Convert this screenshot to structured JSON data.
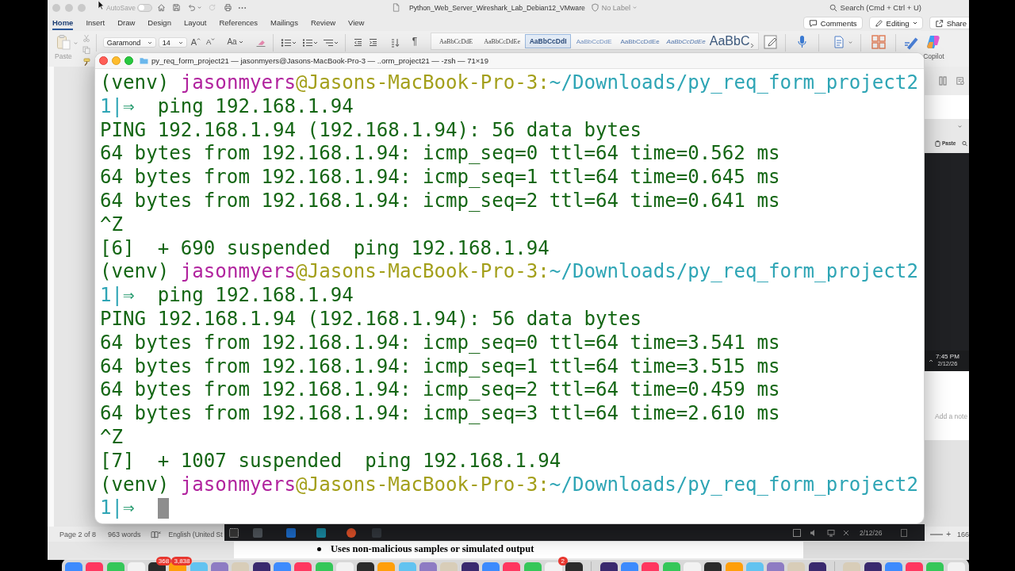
{
  "word": {
    "titlebar": {
      "autosave_label": "AutoSave",
      "autosave_on": false,
      "document_title": "Python_Web_Server_Wireshark_Lab_Debian12_VMware",
      "sensitivity_label": "No Label",
      "search": {
        "placeholder": "Search (Cmd + Ctrl + U)"
      }
    },
    "tabs": [
      {
        "label": "Home",
        "selected": true
      },
      {
        "label": "Insert",
        "selected": false
      },
      {
        "label": "Draw",
        "selected": false
      },
      {
        "label": "Design",
        "selected": false
      },
      {
        "label": "Layout",
        "selected": false
      },
      {
        "label": "References",
        "selected": false
      },
      {
        "label": "Mailings",
        "selected": false
      },
      {
        "label": "Review",
        "selected": false
      },
      {
        "label": "View",
        "selected": false
      }
    ],
    "actions": [
      {
        "kind": "comments",
        "label": "Comments"
      },
      {
        "kind": "editing",
        "label": "Editing"
      },
      {
        "kind": "share",
        "label": "Share"
      }
    ],
    "ribbon": {
      "paste_label": "Paste",
      "font": "Garamond",
      "font_size": "14",
      "font_buttons": [
        {
          "kind": "grow",
          "label": "A"
        },
        {
          "kind": "shrink",
          "label": "A"
        }
      ],
      "change_case_label": "Aa",
      "formatting_marks": "¶",
      "styles": [
        {
          "kind": "normal",
          "sample": "AaBbCcDdE",
          "selected": false
        },
        {
          "kind": "no-spacing",
          "sample": "AaBbCcDdEe",
          "selected": false
        },
        {
          "kind": "heading-1",
          "sample": "AaBbCcDdI",
          "selected": true
        },
        {
          "kind": "heading-2",
          "sample": "AaBbCcDdE",
          "selected": false
        },
        {
          "kind": "heading-3",
          "sample": "AaBbCcDdEe",
          "selected": false
        },
        {
          "kind": "subtle",
          "sample": "AaBbCcDdEe",
          "selected": false
        },
        {
          "kind": "title",
          "sample": "AaBbC",
          "selected": false
        }
      ],
      "copilot_label": "Copilot"
    },
    "notes": {
      "placeholder": "Add a note"
    },
    "status_bar": {
      "page": "Page 2 of 8",
      "words": "963 words",
      "language": "English (United St",
      "zoom_in": "+",
      "zoom": "166"
    },
    "document": {
      "bullets": [
        "Uses non-malicious samples or simulated output"
      ]
    }
  },
  "vm_window": {
    "toolbar_label": "Paste",
    "time": "7:45 PM",
    "date": "2/12/26"
  },
  "vm_taskbar": {
    "date": "2/12/26"
  },
  "terminal": {
    "title": "py_req_form_project21 — jasonmyers@Jasons-MacBook-Pro-3 — ..orm_project21 — -zsh — 71×19",
    "cursor_visible": true,
    "lines": [
      {
        "segments": [
          {
            "text": "(venv) ",
            "color": "#146614"
          },
          {
            "text": "jasonmyers",
            "color": "#b1239e"
          },
          {
            "text": "@Jasons-MacBook-Pro-3:",
            "color": "#a39f1a"
          },
          {
            "text": "~/Downloads/py_req_form_project2",
            "color": "#2ea5b5"
          }
        ]
      },
      {
        "segments": [
          {
            "text": "1|",
            "color": "#2ea5b5"
          },
          {
            "text": "⇒",
            "color": "#259a6e"
          },
          {
            "text": "  ping 192.168.1.94",
            "color": "#146614"
          }
        ]
      },
      {
        "segments": [
          {
            "text": "PING 192.168.1.94 (192.168.1.94): 56 data bytes",
            "color": "#146614"
          }
        ]
      },
      {
        "segments": [
          {
            "text": "64 bytes from 192.168.1.94: icmp_seq=0 ttl=64 time=0.562 ms",
            "color": "#146614"
          }
        ]
      },
      {
        "segments": [
          {
            "text": "64 bytes from 192.168.1.94: icmp_seq=1 ttl=64 time=0.645 ms",
            "color": "#146614"
          }
        ]
      },
      {
        "segments": [
          {
            "text": "64 bytes from 192.168.1.94: icmp_seq=2 ttl=64 time=0.641 ms",
            "color": "#146614"
          }
        ]
      },
      {
        "segments": [
          {
            "text": "^Z",
            "color": "#146614"
          }
        ]
      },
      {
        "segments": [
          {
            "text": "[6]  + 690 suspended  ping 192.168.1.94",
            "color": "#146614"
          }
        ]
      },
      {
        "segments": [
          {
            "text": "(venv) ",
            "color": "#146614"
          },
          {
            "text": "jasonmyers",
            "color": "#b1239e"
          },
          {
            "text": "@Jasons-MacBook-Pro-3:",
            "color": "#a39f1a"
          },
          {
            "text": "~/Downloads/py_req_form_project2",
            "color": "#2ea5b5"
          }
        ]
      },
      {
        "segments": [
          {
            "text": "1|",
            "color": "#2ea5b5"
          },
          {
            "text": "⇒",
            "color": "#259a6e"
          },
          {
            "text": "  ping 192.168.1.94",
            "color": "#146614"
          }
        ]
      },
      {
        "segments": [
          {
            "text": "PING 192.168.1.94 (192.168.1.94): 56 data bytes",
            "color": "#146614"
          }
        ]
      },
      {
        "segments": [
          {
            "text": "64 bytes from 192.168.1.94: icmp_seq=0 ttl=64 time=3.541 ms",
            "color": "#146614"
          }
        ]
      },
      {
        "segments": [
          {
            "text": "64 bytes from 192.168.1.94: icmp_seq=1 ttl=64 time=3.515 ms",
            "color": "#146614"
          }
        ]
      },
      {
        "segments": [
          {
            "text": "64 bytes from 192.168.1.94: icmp_seq=2 ttl=64 time=0.459 ms",
            "color": "#146614"
          }
        ]
      },
      {
        "segments": [
          {
            "text": "64 bytes from 192.168.1.94: icmp_seq=3 ttl=64 time=2.610 ms",
            "color": "#146614"
          }
        ]
      },
      {
        "segments": [
          {
            "text": "^Z",
            "color": "#146614"
          }
        ]
      },
      {
        "segments": [
          {
            "text": "[7]  + 1007 suspended  ping 192.168.1.94",
            "color": "#146614"
          }
        ]
      },
      {
        "segments": [
          {
            "text": "(venv) ",
            "color": "#146614"
          },
          {
            "text": "jasonmyers",
            "color": "#b1239e"
          },
          {
            "text": "@Jasons-MacBook-Pro-3:",
            "color": "#a39f1a"
          },
          {
            "text": "~/Downloads/py_req_form_project2",
            "color": "#2ea5b5"
          }
        ]
      },
      {
        "segments": [
          {
            "text": "1|",
            "color": "#2ea5b5"
          },
          {
            "text": "⇒",
            "color": "#259a6e"
          }
        ]
      }
    ]
  },
  "dock": {
    "badges": [
      "368",
      "3,838",
      "2"
    ]
  }
}
